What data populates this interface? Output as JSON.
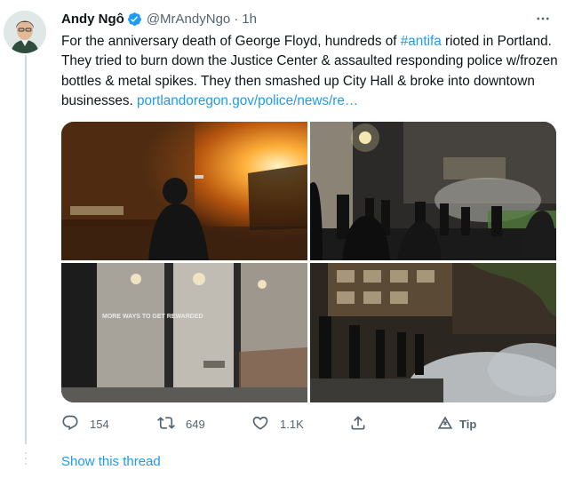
{
  "tweet": {
    "author_name": "Andy Ngô",
    "handle": "@MrAndyNgo",
    "separator": "·",
    "time": "1h",
    "text_before_hashtag": "For the anniversary death of George Floyd, hundreds of ",
    "hashtag": "#antifa",
    "text_after_hashtag": " rioted in Portland. They tried to burn down the Justice Center & assaulted responding police w/frozen bottles & metal spikes. They then smashed up City Hall & broke into downtown businesses. ",
    "link_text": "portlandoregon.gov/police/news/re…",
    "media_sign_text": "MORE WAYS TO GET REWARDED"
  },
  "actions": {
    "reply_count": "154",
    "retweet_count": "649",
    "like_count": "1.1K",
    "tip_label": "Tip"
  },
  "icons": {
    "verified": "verified-badge-icon",
    "more": "more-options-icon",
    "reply": "reply-icon",
    "retweet": "retweet-icon",
    "like": "like-icon",
    "share": "share-icon",
    "tip": "tip-icon"
  },
  "colors": {
    "accent": "#1d9bf0",
    "text": "#0f1419",
    "secondary": "#536471"
  },
  "footer": {
    "show_thread_label": "Show this thread"
  }
}
